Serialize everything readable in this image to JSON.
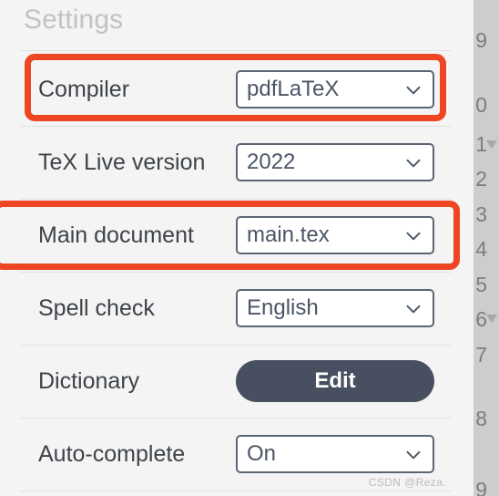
{
  "panel": {
    "title": "Settings",
    "rows": [
      {
        "label": "Compiler",
        "control": "select",
        "value": "pdfLaTeX",
        "highlighted": true
      },
      {
        "label": "TeX Live version",
        "control": "select",
        "value": "2022",
        "highlighted": false
      },
      {
        "label": "Main document",
        "control": "select",
        "value": "main.tex",
        "highlighted": true
      },
      {
        "label": "Spell check",
        "control": "select",
        "value": "English",
        "highlighted": false
      },
      {
        "label": "Dictionary",
        "control": "button",
        "value": "Edit",
        "highlighted": false
      },
      {
        "label": "Auto-complete",
        "control": "select",
        "value": "On",
        "highlighted": false
      }
    ]
  },
  "gutter": {
    "line_numbers": [
      "9",
      "0",
      "1",
      "2",
      "3",
      "4",
      "5",
      "6",
      "7",
      "8",
      "9"
    ],
    "fold_markers": 2
  },
  "watermark": "CSDN @Reza.",
  "colors": {
    "panel_background": "#f4f4f4",
    "highlight": "#ee4623",
    "button": "#474f60",
    "select_border": "#5c6673",
    "label_text": "#3e4349",
    "title_text": "#c2c2c2",
    "gutter_background": "#cdcdcd"
  }
}
